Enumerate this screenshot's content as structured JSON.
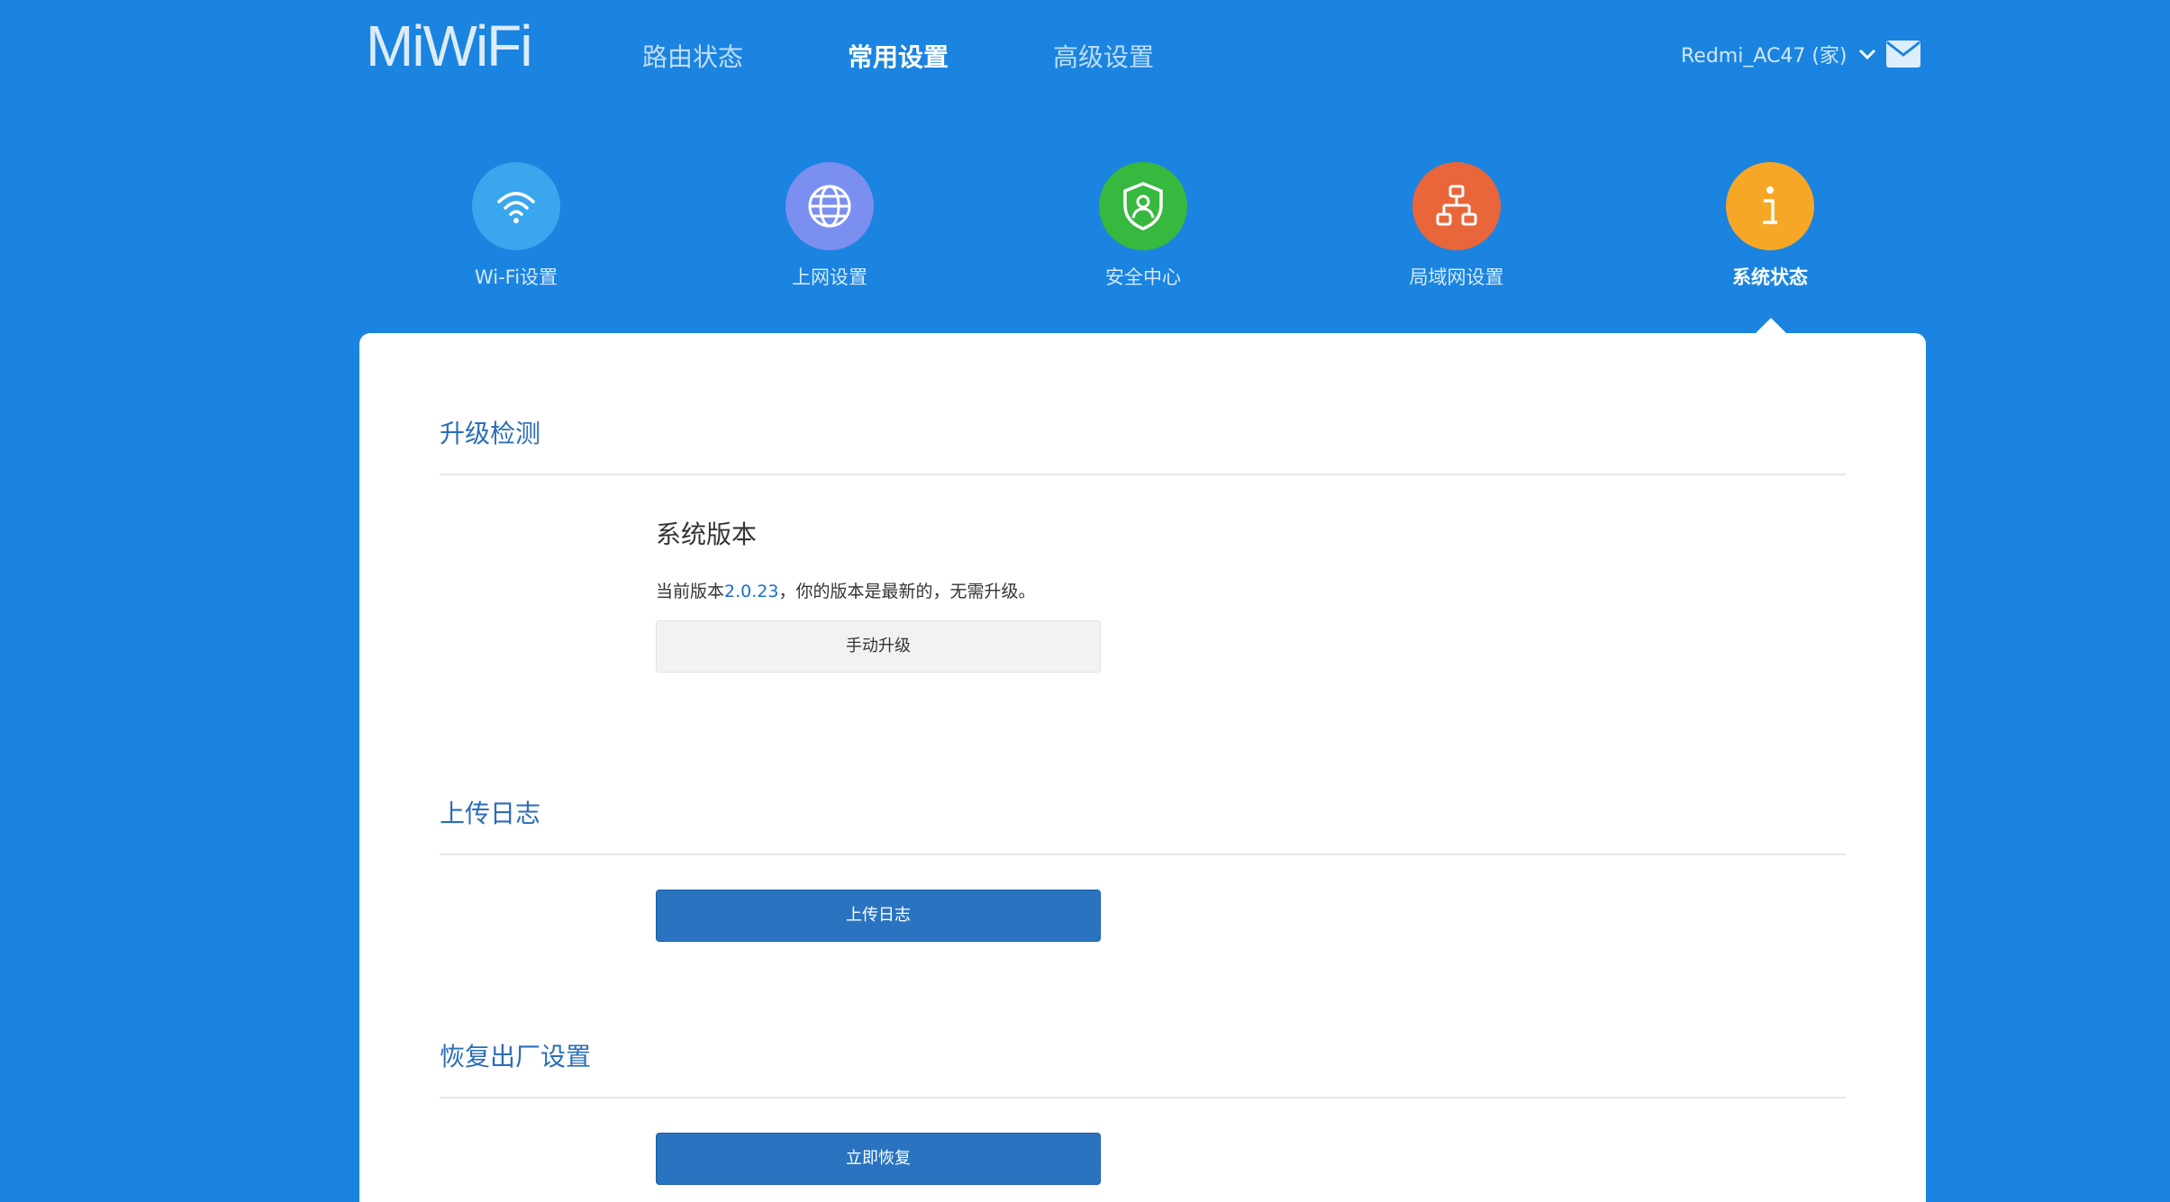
{
  "header": {
    "logo": "MiWiFi",
    "nav": [
      {
        "label": "路由状态",
        "active": false
      },
      {
        "label": "常用设置",
        "active": true
      },
      {
        "label": "高级设置",
        "active": false
      }
    ],
    "router_name": "Redmi_AC47 (家)",
    "router_chevron_icon": "chevron-down-icon",
    "mail_icon": "mail-icon"
  },
  "features": [
    {
      "label": "Wi-Fi设置",
      "icon": "wifi-icon",
      "color": "#39a6ee",
      "active": false
    },
    {
      "label": "上网设置",
      "icon": "globe-icon",
      "color": "#7b8ff0",
      "active": false
    },
    {
      "label": "安全中心",
      "icon": "shield-icon",
      "color": "#37b83e",
      "active": false
    },
    {
      "label": "局域网设置",
      "icon": "network-icon",
      "color": "#e8663a",
      "active": false
    },
    {
      "label": "系统状态",
      "icon": "info-icon",
      "color": "#f7a726",
      "active": true
    }
  ],
  "upgrade": {
    "title": "升级检测",
    "subtitle": "系统版本",
    "desc_prefix": "当前版本",
    "version": "2.0.23",
    "desc_suffix": "，你的版本是最新的，无需升级。",
    "button": "手动升级"
  },
  "log": {
    "title": "上传日志",
    "button": "上传日志"
  },
  "reset": {
    "title": "恢复出厂设置",
    "button": "立即恢复"
  },
  "colors": {
    "background": "#1a84e0",
    "section_title": "#2b6db7",
    "primary_button": "#2a73c0"
  }
}
